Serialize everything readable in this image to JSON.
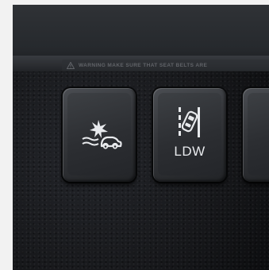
{
  "scene": {
    "warning_label": "WARNING  MAKE SURE THAT SEAT BELTS ARE",
    "switches": [
      {
        "icon": "forward-collision-icon",
        "label": ""
      },
      {
        "icon": "lane-departure-icon",
        "label": "LDW"
      },
      {
        "icon": "",
        "label": ""
      }
    ]
  },
  "colors": {
    "panel": "#17181b",
    "switch": "#36383c",
    "symbol": "#e8eaed"
  }
}
